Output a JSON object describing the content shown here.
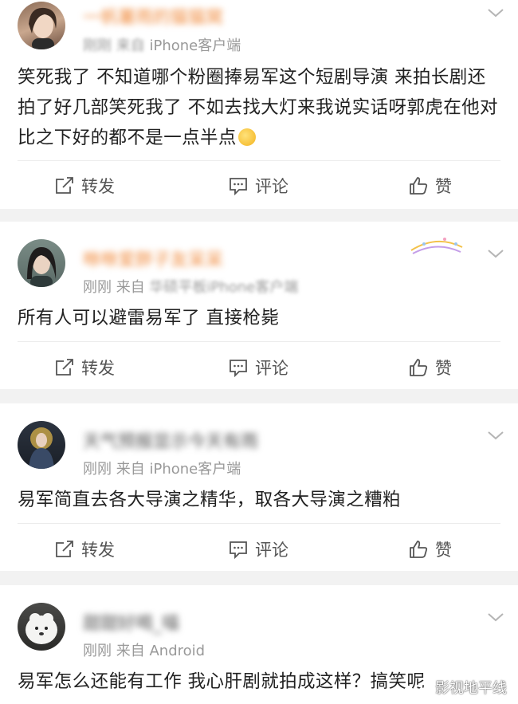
{
  "posts": [
    {
      "username": "一帆薯雨的猫猫窝",
      "time": "刚刚",
      "source_prefix": "来自",
      "source": "iPhone客户端",
      "text": "笑死我了 不知道哪个粉圈捧易军这个短剧导演 来拍长剧还拍了好几部笑死我了 不如去找大灯来我说实话呀郭虎在他对比之下好的都不是一点半点",
      "emoji_icon": "laughing-crying-emoji"
    },
    {
      "username": "咻咻爱胖子友呆呆",
      "time": "刚刚",
      "source_prefix": "来自",
      "source": "华硕平板iPhone客户端",
      "text": "所有人可以避雷易军了 直接枪毙"
    },
    {
      "username": "天气预报显示今天有雨",
      "time": "刚刚",
      "source_prefix": "来自",
      "source": "iPhone客户端",
      "text": "易军简直去各大导演之精华，取各大导演之糟粕"
    },
    {
      "username": "甜甜好喝_喵",
      "time": "刚刚",
      "source_prefix": "来自",
      "source": "Android",
      "text": "易军怎么还能有工作 我心肝剧就拍成这样？搞笑呢"
    }
  ],
  "actions": {
    "repost": "转发",
    "comment": "评论",
    "like": "赞"
  },
  "watermark": "影视地平线",
  "colors": {
    "username": "#f08a3c",
    "meta": "#999999",
    "text": "#222222",
    "background": "#f2f2f2"
  }
}
